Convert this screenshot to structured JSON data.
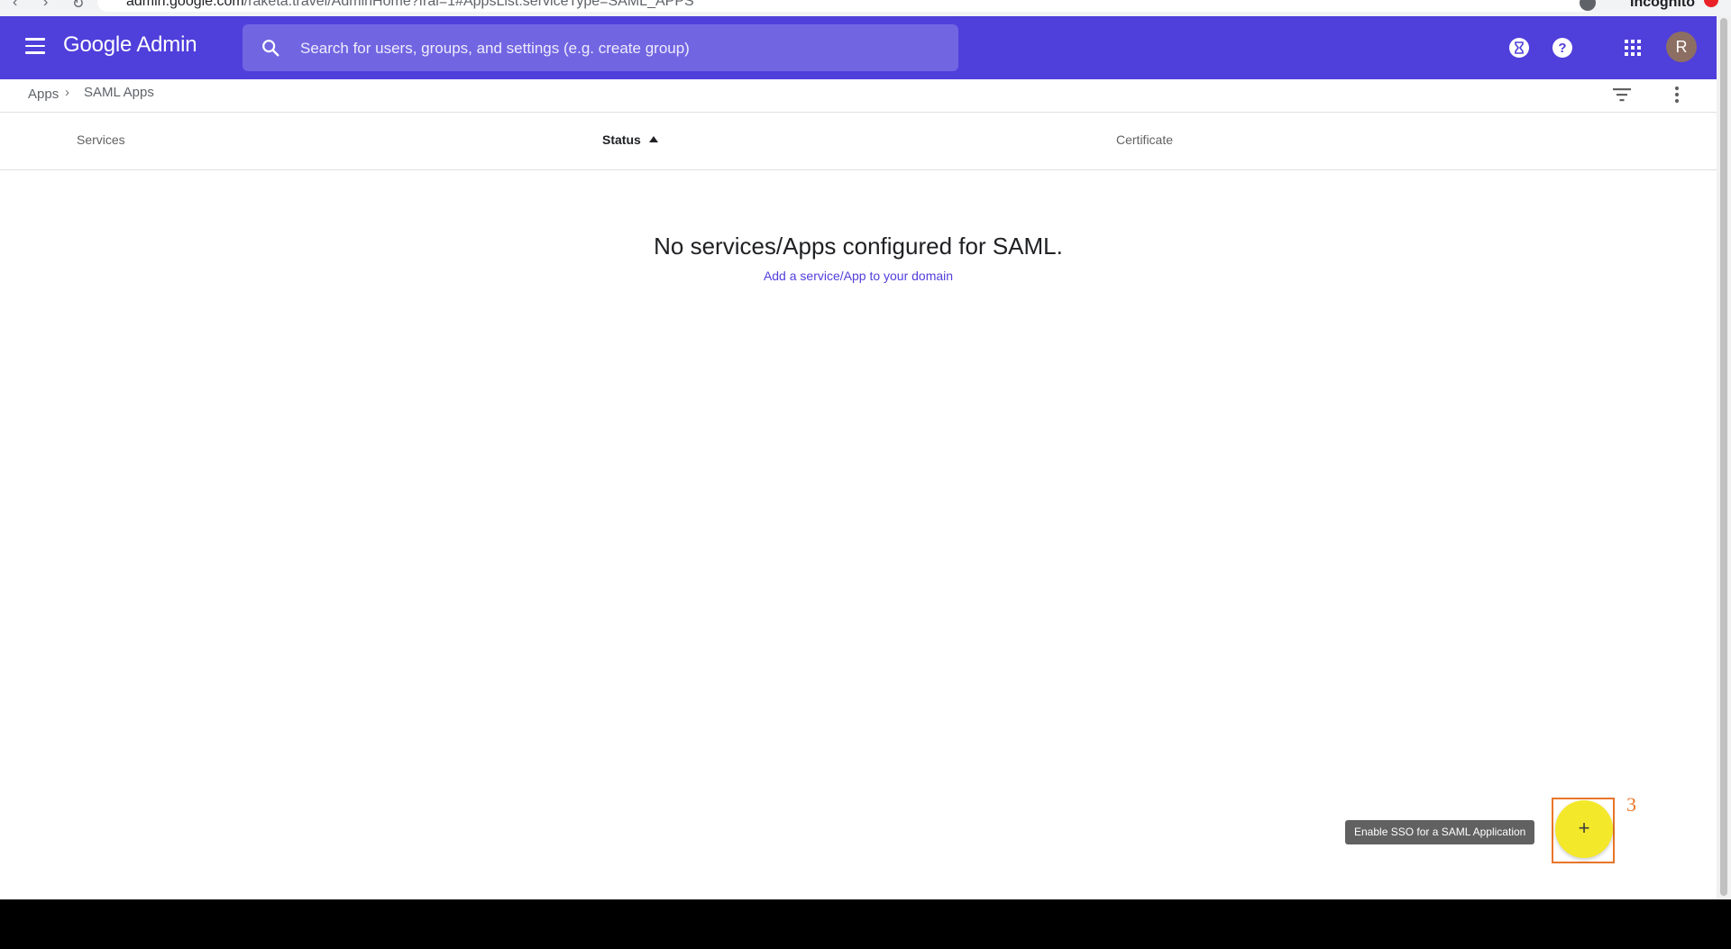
{
  "browser": {
    "url_host": "admin.google.com",
    "url_path": "/raketa.travel/AdminHome?fral=1#AppsList:serviceType=SAML_APPS",
    "incognito_label": "Incognito"
  },
  "header": {
    "logo_text": "Google Admin",
    "search_placeholder": "Search for users, groups, and settings (e.g. create group)",
    "avatar_letter": "R"
  },
  "breadcrumb": {
    "parent": "Apps",
    "separator": "›",
    "current": "SAML Apps"
  },
  "table": {
    "columns": {
      "services": "Services",
      "status": "Status",
      "certificate": "Certificate"
    }
  },
  "empty_state": {
    "title": "No services/Apps configured for SAML.",
    "link": "Add a service/App to your domain"
  },
  "fab": {
    "icon": "plus-icon",
    "symbol": "+",
    "tooltip": "Enable SSO for a SAML Application",
    "annotation": "3"
  },
  "colors": {
    "header_bg": "#4f3fdb",
    "fab_bg": "#f4e82a",
    "annotation": "#e8752a"
  }
}
